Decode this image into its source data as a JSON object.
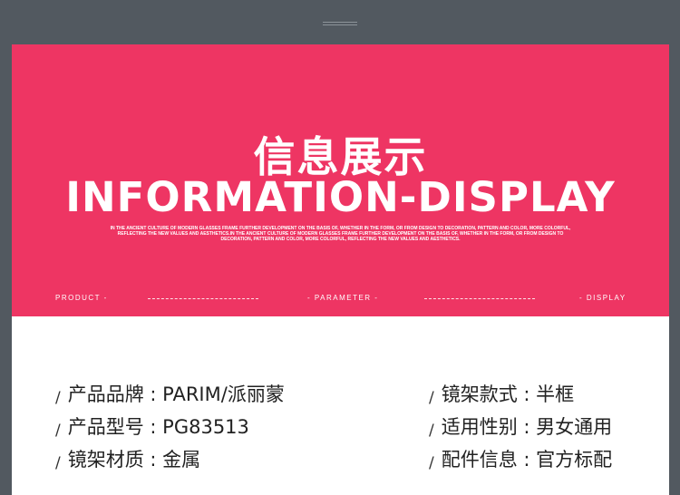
{
  "header": {
    "title_cn": "信息展示",
    "title_en": "INFORMATION-DISPLAY",
    "description": "IN THE ANCIENT CULTURE OF MODERN GLASSES FRAME FURTHER DEVELOPMENT ON THE BASIS OF, WHETHER IN THE FORM, OR FROM DESIGN TO DECORATION, PATTERN AND COLOR, MORE COLORFUL, REFLECTING THE NEW VALUES AND AESTHETICS.IN THE ANCIENT CULTURE OF MODERN GLASSES FRAME FURTHER DEVELOPMENT ON THE BASIS OF, WHETHER IN THE FORM, OR FROM DESIGN TO DECORATION, PATTERN AND COLOR, MORE COLORFUL, REFLECTING THE NEW VALUES AND AESTHETICS."
  },
  "nav": {
    "product": "PRODUCT -",
    "parameter": "- PARAMETER -",
    "display": "- DISPLAY"
  },
  "specs": [
    {
      "label": "产品品牌 : PARIM/派丽蒙"
    },
    {
      "label": "镜架款式 : 半框"
    },
    {
      "label": "产品型号 : PG83513"
    },
    {
      "label": "适用性别 : 男女通用"
    },
    {
      "label": "镜架材质 : 金属"
    },
    {
      "label": "配件信息 : 官方标配"
    }
  ],
  "colors": {
    "accent": "#ee3563",
    "background": "#525960"
  }
}
